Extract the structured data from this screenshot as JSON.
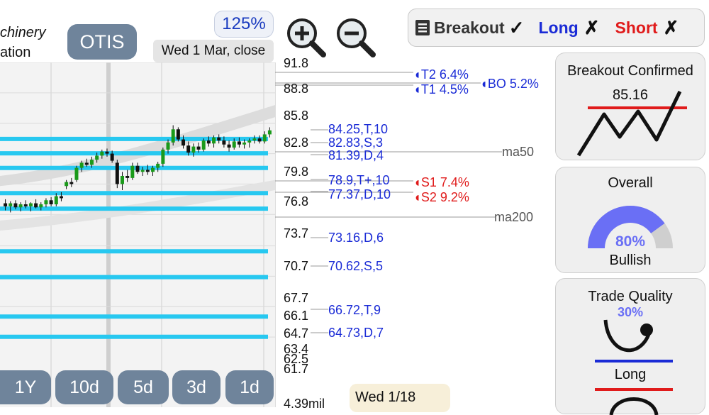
{
  "header": {
    "title_line1": "chinery",
    "title_line2": "ation",
    "ticker": "OTIS",
    "zoom_percent": "125%",
    "date_label": "Wed 1 Mar, close"
  },
  "icons": {
    "zoom_in": "zoom-in-icon",
    "zoom_out": "zoom-out-icon"
  },
  "price_axis": [
    "91.8",
    "88.8",
    "85.8",
    "82.8",
    "79.8",
    "76.8",
    "73.7",
    "70.7",
    "67.7",
    "66.1",
    "64.7",
    "63.4",
    "62.5",
    "61.7",
    "4.39mil"
  ],
  "support_resistance": [
    "84.25,T,10",
    "82.83,S,3",
    "81.39,D,4",
    "78.9,T+,10",
    "77.37,D,10",
    "73.16,D,6",
    "70.62,S,5",
    "66.72,T,9",
    "64.73,D,7"
  ],
  "targets": {
    "t2": "T2 6.4%",
    "t1": "T1 4.5%",
    "bo": "BO 5.2%",
    "s1": "S1 7.4%",
    "s2": "S2 9.2%"
  },
  "moving_averages": {
    "ma50": "ma50",
    "ma200": "ma200"
  },
  "strategy": {
    "breakout_label": "Breakout",
    "breakout_mark": "✓",
    "long_label": "Long",
    "long_mark": "✗",
    "short_label": "Short",
    "short_mark": "✗"
  },
  "cards": {
    "breakout": {
      "title": "Breakout Confirmed",
      "value": "85.16"
    },
    "overall": {
      "title": "Overall",
      "percent": "80%",
      "percent_value": 80,
      "verdict": "Bullish"
    },
    "trade_quality": {
      "title": "Trade Quality",
      "percent": "30%",
      "direction": "Long"
    }
  },
  "periods": [
    "1Y",
    "10d",
    "5d",
    "3d",
    "1d"
  ],
  "tooltip": {
    "date": "Wed 1/18"
  },
  "colors": {
    "support_line": "#27c8f0",
    "ticker_bg": "#6f849b",
    "blue_text": "#1a2bd6",
    "red_text": "#e01b1b",
    "gauge_fill": "#6a6ff5",
    "candle_up": "#1a9a1a",
    "candle_down": "#111111"
  },
  "chart_data": {
    "type": "candlestick",
    "support_levels": [
      84.25,
      82.83,
      81.39,
      78.9,
      77.37,
      73.16,
      70.62,
      66.72,
      64.73
    ],
    "candles": [
      {
        "o": 77.9,
        "h": 78.3,
        "l": 77.2,
        "c": 77.6
      },
      {
        "o": 77.6,
        "h": 78.1,
        "l": 77.0,
        "c": 77.9
      },
      {
        "o": 77.9,
        "h": 78.2,
        "l": 77.3,
        "c": 77.5
      },
      {
        "o": 77.5,
        "h": 78.0,
        "l": 77.1,
        "c": 77.8
      },
      {
        "o": 77.8,
        "h": 78.2,
        "l": 77.4,
        "c": 77.6
      },
      {
        "o": 77.6,
        "h": 78.0,
        "l": 77.1,
        "c": 77.9
      },
      {
        "o": 77.9,
        "h": 78.3,
        "l": 77.4,
        "c": 77.5
      },
      {
        "o": 77.5,
        "h": 78.0,
        "l": 77.2,
        "c": 77.8
      },
      {
        "o": 77.8,
        "h": 78.4,
        "l": 77.5,
        "c": 78.2
      },
      {
        "o": 78.2,
        "h": 78.5,
        "l": 77.6,
        "c": 77.8
      },
      {
        "o": 77.8,
        "h": 78.9,
        "l": 77.6,
        "c": 78.6
      },
      {
        "o": 78.6,
        "h": 79.0,
        "l": 78.1,
        "c": 78.4
      },
      {
        "o": 79.6,
        "h": 80.2,
        "l": 79.3,
        "c": 80.0
      },
      {
        "o": 80.0,
        "h": 80.4,
        "l": 79.5,
        "c": 79.8
      },
      {
        "o": 80.2,
        "h": 81.6,
        "l": 80.0,
        "c": 81.4
      },
      {
        "o": 81.4,
        "h": 82.1,
        "l": 81.0,
        "c": 81.9
      },
      {
        "o": 81.9,
        "h": 82.3,
        "l": 81.5,
        "c": 81.7
      },
      {
        "o": 81.7,
        "h": 82.5,
        "l": 81.4,
        "c": 82.2
      },
      {
        "o": 82.2,
        "h": 82.9,
        "l": 81.9,
        "c": 82.6
      },
      {
        "o": 82.6,
        "h": 83.2,
        "l": 82.3,
        "c": 83.0
      },
      {
        "o": 83.0,
        "h": 83.3,
        "l": 82.5,
        "c": 82.8
      },
      {
        "o": 82.8,
        "h": 83.1,
        "l": 81.9,
        "c": 82.1
      },
      {
        "o": 81.9,
        "h": 82.2,
        "l": 79.4,
        "c": 79.8
      },
      {
        "o": 79.8,
        "h": 81.0,
        "l": 79.2,
        "c": 80.6
      },
      {
        "o": 80.6,
        "h": 81.2,
        "l": 80.0,
        "c": 80.4
      },
      {
        "o": 80.4,
        "h": 81.9,
        "l": 80.2,
        "c": 81.6
      },
      {
        "o": 81.6,
        "h": 81.9,
        "l": 80.8,
        "c": 81.0
      },
      {
        "o": 81.0,
        "h": 81.5,
        "l": 80.6,
        "c": 81.2
      },
      {
        "o": 81.2,
        "h": 81.7,
        "l": 80.7,
        "c": 81.0
      },
      {
        "o": 81.0,
        "h": 81.6,
        "l": 80.6,
        "c": 81.4
      },
      {
        "o": 81.4,
        "h": 82.0,
        "l": 81.0,
        "c": 81.8
      },
      {
        "o": 81.8,
        "h": 83.4,
        "l": 81.5,
        "c": 83.2
      },
      {
        "o": 83.2,
        "h": 84.2,
        "l": 82.8,
        "c": 83.9
      },
      {
        "o": 83.9,
        "h": 85.6,
        "l": 83.6,
        "c": 85.2
      },
      {
        "o": 85.2,
        "h": 85.4,
        "l": 84.0,
        "c": 84.2
      },
      {
        "o": 84.2,
        "h": 84.6,
        "l": 83.3,
        "c": 83.6
      },
      {
        "o": 83.6,
        "h": 84.0,
        "l": 82.6,
        "c": 82.9
      },
      {
        "o": 82.9,
        "h": 83.8,
        "l": 82.5,
        "c": 83.5
      },
      {
        "o": 83.5,
        "h": 83.9,
        "l": 82.9,
        "c": 83.2
      },
      {
        "o": 83.2,
        "h": 84.3,
        "l": 83.0,
        "c": 84.1
      },
      {
        "o": 84.1,
        "h": 84.5,
        "l": 83.5,
        "c": 83.8
      },
      {
        "o": 83.8,
        "h": 84.6,
        "l": 83.4,
        "c": 84.4
      },
      {
        "o": 84.4,
        "h": 84.7,
        "l": 83.8,
        "c": 84.1
      },
      {
        "o": 84.1,
        "h": 84.5,
        "l": 83.4,
        "c": 83.7
      },
      {
        "o": 83.7,
        "h": 84.1,
        "l": 83.0,
        "c": 83.4
      },
      {
        "o": 83.4,
        "h": 84.3,
        "l": 83.2,
        "c": 84.0
      },
      {
        "o": 84.0,
        "h": 84.4,
        "l": 83.4,
        "c": 83.7
      },
      {
        "o": 83.7,
        "h": 84.2,
        "l": 83.3,
        "c": 83.9
      },
      {
        "o": 83.9,
        "h": 84.3,
        "l": 83.4,
        "c": 84.1
      },
      {
        "o": 84.1,
        "h": 84.6,
        "l": 83.8,
        "c": 84.3
      },
      {
        "o": 84.3,
        "h": 84.6,
        "l": 83.8,
        "c": 84.0
      },
      {
        "o": 84.0,
        "h": 85.0,
        "l": 83.8,
        "c": 84.7
      },
      {
        "o": 84.7,
        "h": 85.4,
        "l": 84.4,
        "c": 85.1
      }
    ]
  }
}
